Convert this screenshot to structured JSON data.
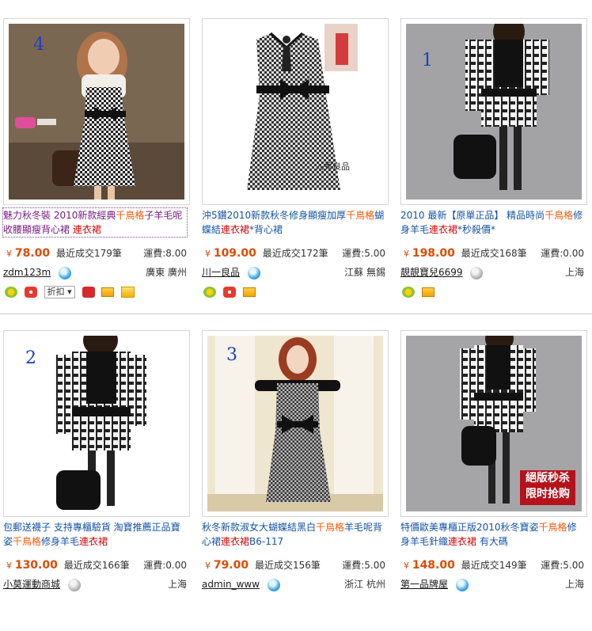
{
  "items": [
    {
      "badge_num": "4",
      "title_pre": "魅力秋冬裝 2010新款經典",
      "title_hl": "千鳥格",
      "title_mid": "子羊毛呢收腰顯瘦背心裙",
      "title_hl2": "連衣裙",
      "title_post": "",
      "currency": "¥",
      "price": "78.00",
      "sold": "最近成交179筆",
      "shipping": "運費:8.00",
      "seller": "zdm123m",
      "location": "廣東 廣州",
      "discount_label": "折扣",
      "ww_status": "online"
    },
    {
      "badge_num": "",
      "title_pre": "沖5鑽2010新款秋冬修身顯瘦加厚",
      "title_hl": "千鳥格",
      "title_mid": "蝴蝶結",
      "title_hl2": "連衣裙",
      "title_post": "*背心裙",
      "currency": "¥",
      "price": "109.00",
      "sold": "最近成交172筆",
      "shipping": "運費:5.00",
      "seller": "川一良品",
      "location": "江蘇 無錫",
      "watermark": "入秀良品",
      "ww_status": "online"
    },
    {
      "badge_num": "1",
      "title_pre": "2010 最新【原單正品】 精品時尚",
      "title_hl": "千鳥格",
      "title_mid": "修身羊毛",
      "title_hl2": "連衣裙",
      "title_post": "*秒殺價*",
      "currency": "¥",
      "price": "198.00",
      "sold": "最近成交168筆",
      "shipping": "運費:0.00",
      "seller": "靚靚寶兒6699",
      "location": "上海",
      "ww_status": "offline"
    },
    {
      "badge_num": "2",
      "title_pre": "包郵送襪子 支持專櫃驗貨 淘寶推薦正品寶姿",
      "title_hl": "千鳥格",
      "title_mid": "修身羊毛",
      "title_hl2": "連衣裙",
      "title_post": "",
      "currency": "¥",
      "price": "130.00",
      "sold": "最近成交166筆",
      "shipping": "運費:0.00",
      "seller": "小莫運動商城",
      "location": "上海",
      "ww_status": "offline"
    },
    {
      "badge_num": "3",
      "title_pre": "秋冬新款淑女大蝴蝶結黑白",
      "title_hl": "千鳥格",
      "title_mid": "羊毛呢背心裙",
      "title_hl2": "連衣裙",
      "title_post": "B6-117",
      "currency": "¥",
      "price": "79.00",
      "sold": "最近成交156筆",
      "shipping": "運費:5.00",
      "seller": "admin_www",
      "location": "浙江 杭州",
      "ww_status": "online"
    },
    {
      "badge_num": "",
      "title_pre": "特價歐美專櫃正版2010秋冬寶姿",
      "title_hl": "千鳥格",
      "title_mid": "修身羊毛針織",
      "title_hl2": "連衣裙",
      "title_post": " 有大碼",
      "currency": "¥",
      "price": "148.00",
      "sold": "最近成交149筆",
      "shipping": "運費:5.00",
      "seller": "第一品牌屋",
      "location": "上海",
      "stamp_line1": "絕版秒杀",
      "stamp_line2": "限时抢购",
      "ww_status": "online"
    }
  ],
  "colors": {
    "link": "#1553a6",
    "highlight": "#ff5500",
    "price": "#e14a00",
    "badge_num": "#1d3fc2"
  }
}
